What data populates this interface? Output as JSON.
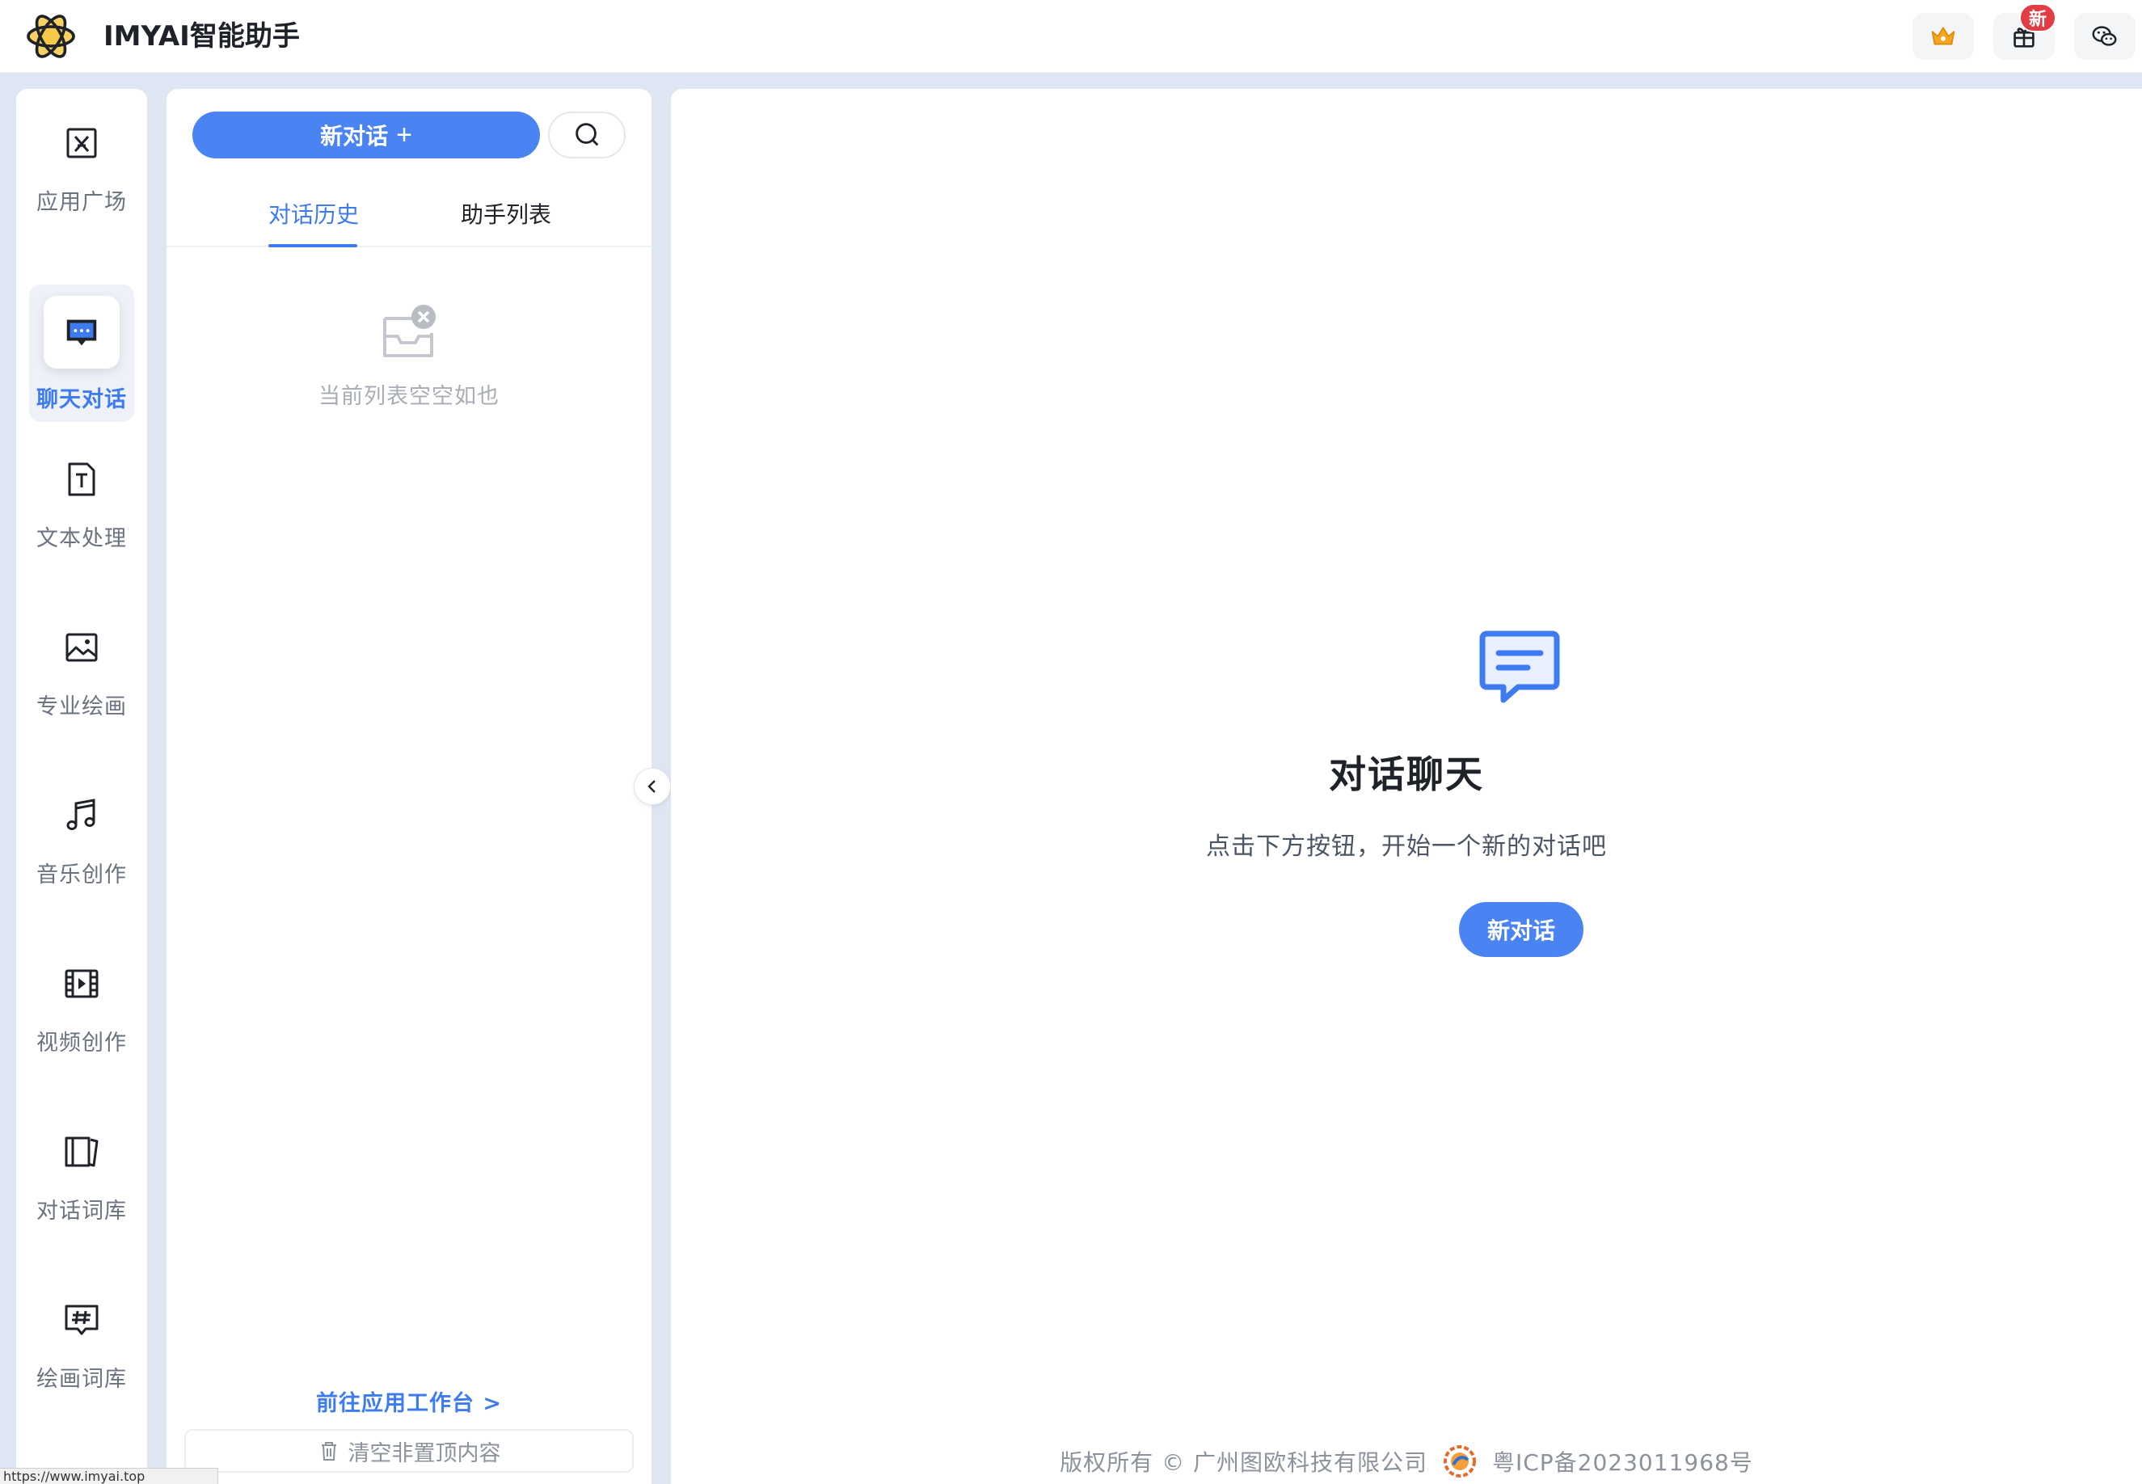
{
  "header": {
    "app_title": "IMYAI智能助手",
    "gift_badge": "新"
  },
  "icons": {
    "logo": "openai-logo-icon",
    "vip": "crown-icon",
    "gift": "gift-icon",
    "wechat": "wechat-icon"
  },
  "colors": {
    "accent": "#3e7bf1",
    "button": "#4a84f3",
    "badge": "#e23c45",
    "crown": "#f5a623"
  },
  "leftnav": {
    "items": [
      {
        "label": "应用广场",
        "icon": "app-store-icon"
      },
      {
        "label": "聊天对话",
        "icon": "chat-bubble-icon",
        "active": true
      },
      {
        "label": "文本处理",
        "icon": "text-document-icon"
      },
      {
        "label": "专业绘画",
        "icon": "image-icon"
      },
      {
        "label": "音乐创作",
        "icon": "music-note-icon"
      },
      {
        "label": "视频创作",
        "icon": "video-film-icon"
      },
      {
        "label": "对话词库",
        "icon": "book-library-icon"
      },
      {
        "label": "绘画词库",
        "icon": "hashtag-board-icon"
      }
    ]
  },
  "panel": {
    "new_chat_label": "新对话",
    "new_chat_plus": "+",
    "tabs": [
      "对话历史",
      "助手列表"
    ],
    "active_tab": "对话历史",
    "empty_text": "当前列表空空如也",
    "goto_link": "前往应用工作台 >",
    "clear_label": "清空非置顶内容"
  },
  "main": {
    "title": "对话聊天",
    "subtitle": "点击下方按钮，开始一个新的对话吧",
    "button_label": "新对话"
  },
  "footer": {
    "copyright": "版权所有 © 广州图欧科技有限公司",
    "icp": "粤ICP备2023011968号"
  },
  "status_tip": "https://www.imyai.top"
}
